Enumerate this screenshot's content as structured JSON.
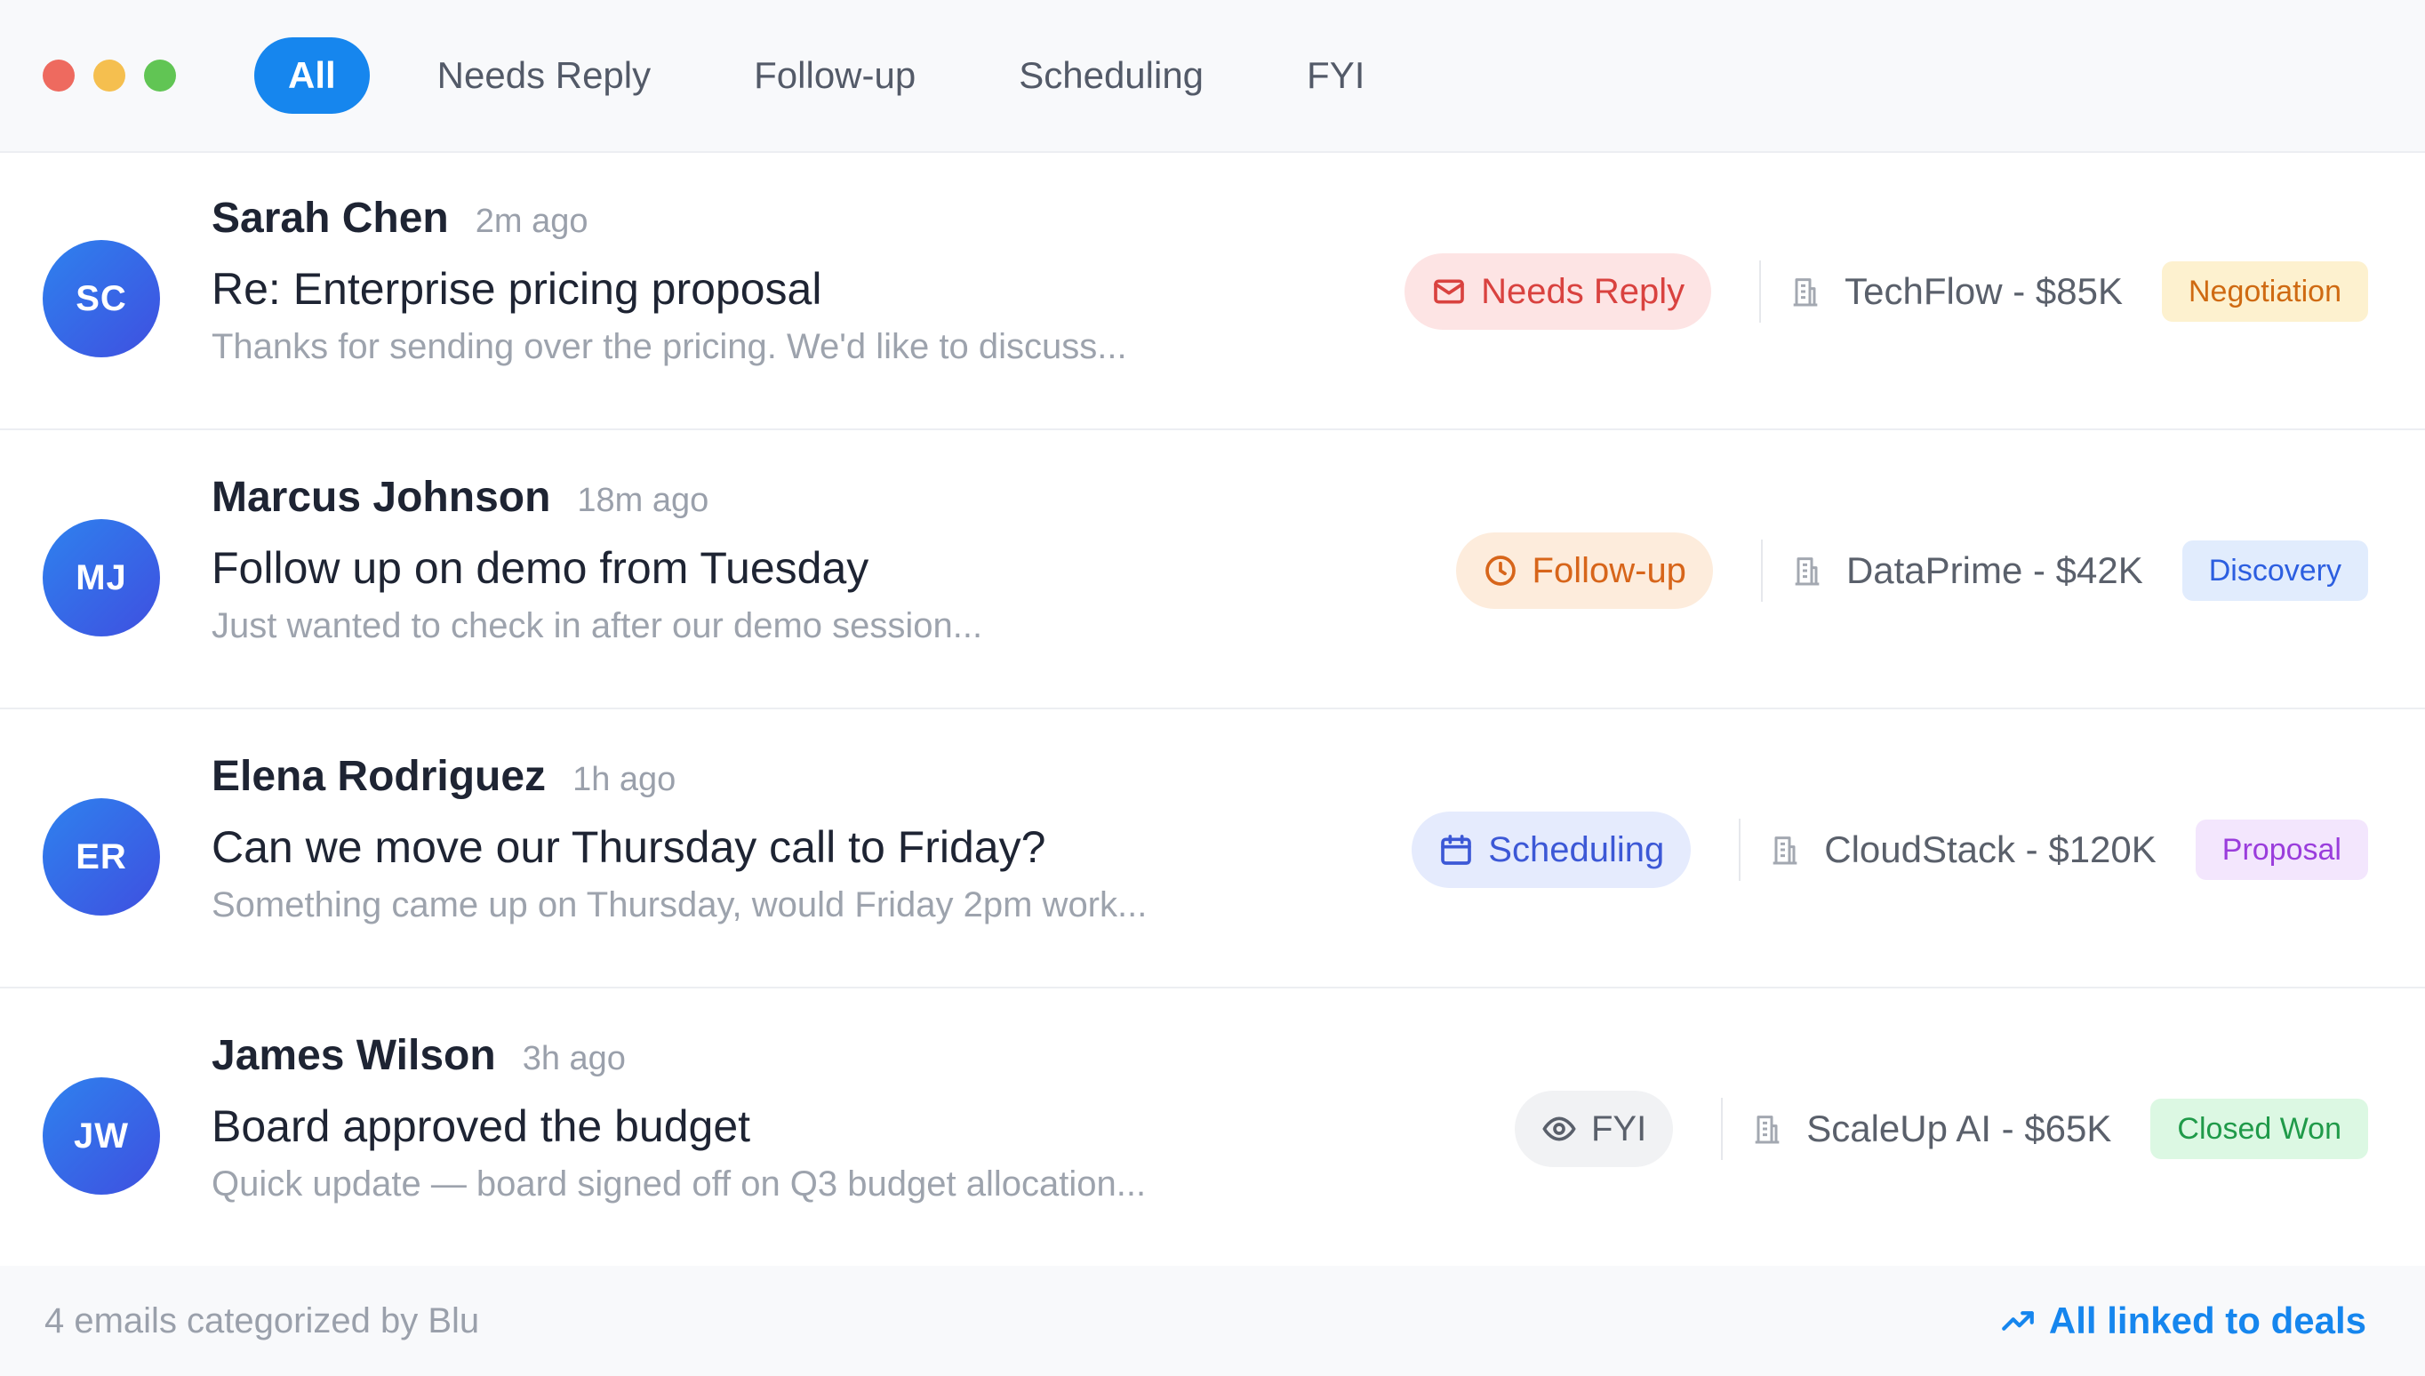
{
  "tabs": [
    {
      "label": "All"
    },
    {
      "label": "Needs Reply"
    },
    {
      "label": "Follow-up"
    },
    {
      "label": "Scheduling"
    },
    {
      "label": "FYI"
    }
  ],
  "emails": [
    {
      "initials": "SC",
      "sender": "Sarah Chen",
      "time": "2m ago",
      "subject": "Re: Enterprise pricing proposal",
      "preview": "Thanks for sending over the pricing. We'd like to discuss...",
      "category": "Needs Reply",
      "category_icon": "envelope-icon",
      "deal": "TechFlow - $85K",
      "stage": "Negotiation",
      "stage_colors": {
        "bg": "#fdf1cf",
        "fg": "#cf6a12"
      }
    },
    {
      "initials": "MJ",
      "sender": "Marcus Johnson",
      "time": "18m ago",
      "subject": "Follow up on demo from Tuesday",
      "preview": "Just wanted to check in after our demo session...",
      "category": "Follow-up",
      "category_icon": "clock-icon",
      "deal": "DataPrime - $42K",
      "stage": "Discovery",
      "stage_colors": {
        "bg": "#e1ecfd",
        "fg": "#2c5ee0"
      }
    },
    {
      "initials": "ER",
      "sender": "Elena Rodriguez",
      "time": "1h ago",
      "subject": "Can we move our Thursday call to Friday?",
      "preview": "Something came up on Thursday, would Friday 2pm work...",
      "category": "Scheduling",
      "category_icon": "calendar-icon",
      "deal": "CloudStack - $120K",
      "stage": "Proposal",
      "stage_colors": {
        "bg": "#f3e6fd",
        "fg": "#9a3ddc"
      }
    },
    {
      "initials": "JW",
      "sender": "James Wilson",
      "time": "3h ago",
      "subject": "Board approved the budget",
      "preview": "Quick update — board signed off on Q3 budget allocation...",
      "category": "FYI",
      "category_icon": "eye-icon",
      "deal": "ScaleUp AI - $65K",
      "stage": "Closed Won",
      "stage_colors": {
        "bg": "#dcf8e3",
        "fg": "#1f9a49"
      }
    }
  ],
  "footer": {
    "summary": "4 emails categorized by Blu",
    "link": "All linked to deals",
    "link_icon": "trending-up-icon"
  },
  "colors": {
    "accent": "#1686ee",
    "avatar_gradient_start": "#2e82ee",
    "avatar_gradient_end": "#3f4fe0"
  }
}
